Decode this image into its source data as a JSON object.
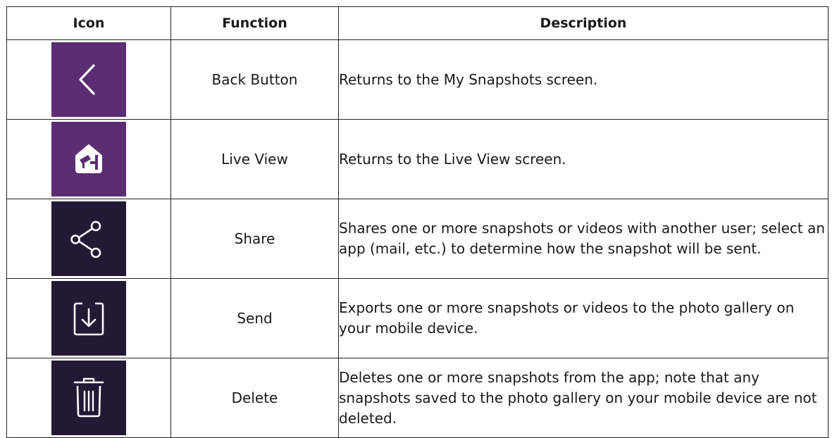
{
  "table": {
    "headers": {
      "icon": "Icon",
      "function": "Function",
      "description": "Description"
    },
    "rows": [
      {
        "icon_name": "chevron-left-icon",
        "icon_bg": "#5b2d73",
        "function": "Back Button",
        "description": "Returns to the My Snapshots screen."
      },
      {
        "icon_name": "home-camera-icon",
        "icon_bg": "#5b2d73",
        "function": "Live View",
        "description": "Returns to the Live View screen."
      },
      {
        "icon_name": "share-icon",
        "icon_bg": "#221a35",
        "function": "Share",
        "description": "Shares one or more snapshots or videos with another user; select an app (mail, etc.) to determine how the snapshot will be sent."
      },
      {
        "icon_name": "download-tray-icon",
        "icon_bg": "#221a35",
        "function": "Send",
        "description": "Exports one or more snapshots or videos to the photo gallery on your mobile device."
      },
      {
        "icon_name": "trash-icon",
        "icon_bg": "#221a35",
        "function": "Delete",
        "description": "Deletes one or more snapshots from the app; note that any snapshots saved to the photo gallery on your mobile device are not deleted."
      }
    ]
  }
}
